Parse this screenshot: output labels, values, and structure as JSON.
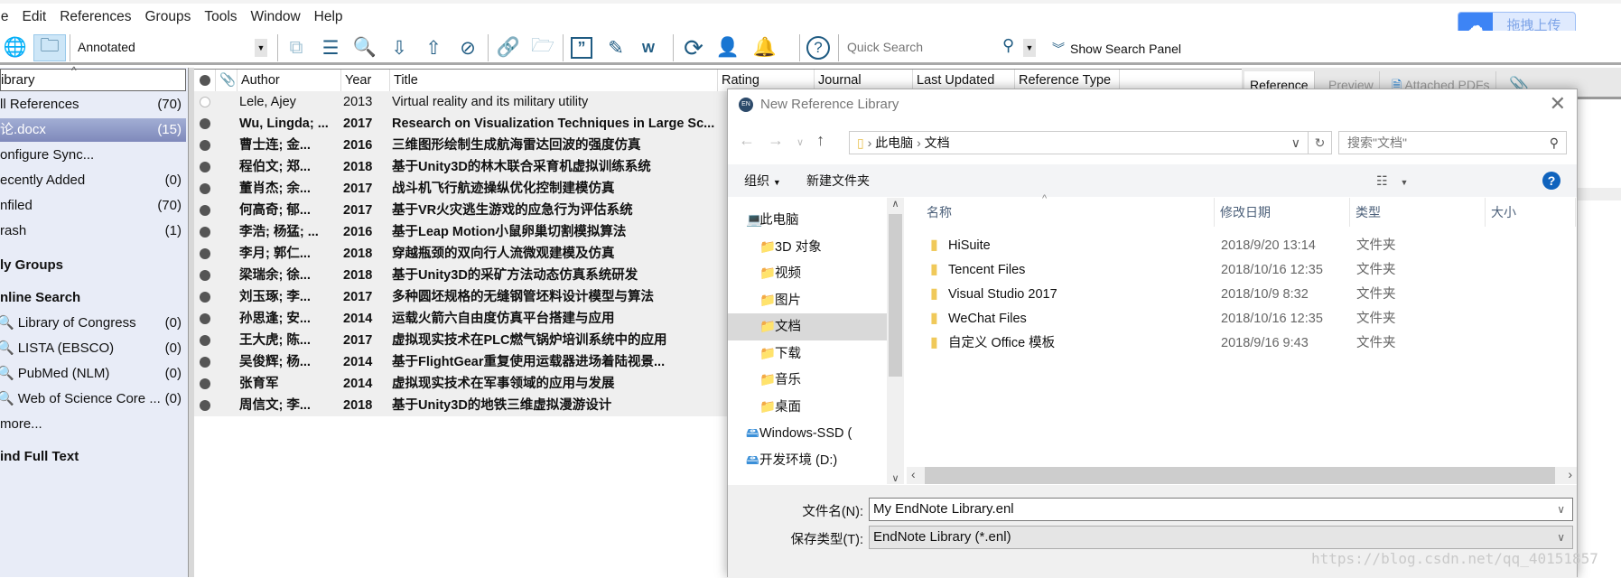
{
  "menu": [
    "ile",
    "Edit",
    "References",
    "Groups",
    "Tools",
    "Window",
    "Help"
  ],
  "toolbar": {
    "style": "Annotated",
    "quick_search_placeholder": "Quick Search",
    "show_search_panel": "Show Search Panel",
    "icons": [
      "online-search-globe-icon",
      "integrated-library-icon",
      "copy-to-group-icon",
      "new-reference-icon",
      "find-online-icon",
      "import-icon",
      "export-icon",
      "find-pdf-icon",
      "link-icon",
      "open-folder-icon",
      "insert-citation-icon",
      "edit-citation-icon",
      "word-icon",
      "sync-icon",
      "share-icon",
      "notifications-icon",
      "help-icon"
    ]
  },
  "baidu": {
    "label": "拖拽上传"
  },
  "sidebar": {
    "header": "ibrary",
    "items": [
      {
        "label": "ll References",
        "count": "(70)"
      },
      {
        "label": "论.docx",
        "count": "(15)",
        "selected": true
      },
      {
        "label": "onfigure Sync...",
        "count": ""
      },
      {
        "label": "ecently Added",
        "count": "(0)"
      },
      {
        "label": "nfiled",
        "count": "(70)"
      },
      {
        "label": "rash",
        "count": "(1)"
      }
    ],
    "my_groups": "ly Groups",
    "online_search": "nline Search",
    "online": [
      {
        "label": "Library of Congress",
        "count": "(0)"
      },
      {
        "label": "LISTA (EBSCO)",
        "count": "(0)"
      },
      {
        "label": "PubMed (NLM)",
        "count": "(0)"
      },
      {
        "label": "Web of Science Core ...",
        "count": "(0)"
      }
    ],
    "more": "more...",
    "find_full_text": "ind Full Text"
  },
  "list": {
    "columns": [
      "Author",
      "Year",
      "Title",
      "Rating",
      "Journal",
      "Last Updated",
      "Reference Type"
    ],
    "rows": [
      {
        "author": "Lele, Ajey",
        "year": "2013",
        "title": "Virtual reality and its military utility",
        "read": true
      },
      {
        "author": "Wu, Lingda; ...",
        "year": "2017",
        "title": "Research on Visualization Techniques in Large Sc...",
        "read": false
      },
      {
        "author": "曹士连; 金...",
        "year": "2016",
        "title": "三维图形绘制生成航海雷达回波的强度仿真",
        "read": false
      },
      {
        "author": "程伯文; 郑...",
        "year": "2018",
        "title": "基于Unity3D的林木联合采育机虚拟训练系统",
        "read": false
      },
      {
        "author": "董肖杰; 余...",
        "year": "2017",
        "title": "战斗机飞行航迹操纵优化控制建模仿真",
        "read": false
      },
      {
        "author": "何高奇; 郁...",
        "year": "2017",
        "title": "基于VR火灾逃生游戏的应急行为评估系统",
        "read": false
      },
      {
        "author": "李浩; 杨猛; ...",
        "year": "2016",
        "title": "基于Leap Motion小鼠卵巢切割模拟算法",
        "read": false
      },
      {
        "author": "李月; 郭仁...",
        "year": "2018",
        "title": "穿越瓶颈的双向行人流微观建模及仿真",
        "read": false
      },
      {
        "author": "梁瑞余; 徐...",
        "year": "2018",
        "title": "基于Unity3D的采矿方法动态仿真系统研发",
        "read": false
      },
      {
        "author": "刘玉琢; 李...",
        "year": "2017",
        "title": "多种圆坯规格的无缝钢管坯料设计模型与算法",
        "read": false
      },
      {
        "author": "孙思逢; 安...",
        "year": "2014",
        "title": "运载火箭六自由度仿真平台搭建与应用",
        "read": false
      },
      {
        "author": "王大虎; 陈...",
        "year": "2017",
        "title": "虚拟现实技术在PLC燃气锅炉培训系统中的应用",
        "read": false
      },
      {
        "author": "吴俊辉; 杨...",
        "year": "2014",
        "title": "基于FlightGear重复使用运载器进场着陆视景...",
        "read": false
      },
      {
        "author": "张育军",
        "year": "2014",
        "title": "虚拟现实技术在军事领域的应用与发展",
        "read": false
      },
      {
        "author": "周信文; 李...",
        "year": "2018",
        "title": "基于Unity3D的地铁三维虚拟漫游设计",
        "read": false
      }
    ]
  },
  "right_tabs": [
    "Reference",
    "Preview",
    "Attached PDFs"
  ],
  "dialog": {
    "title": "New Reference Library",
    "path": [
      "此电脑",
      "文档"
    ],
    "search_placeholder": "搜索\"文档\"",
    "organize": "组织",
    "new_folder": "新建文件夹",
    "nav": [
      "此电脑",
      "3D 对象",
      "视频",
      "图片",
      "文档",
      "下载",
      "音乐",
      "桌面",
      "Windows-SSD (",
      "开发环境 (D:)"
    ],
    "columns": [
      "名称",
      "修改日期",
      "类型",
      "大小"
    ],
    "files": [
      {
        "name": "HiSuite",
        "date": "2018/9/20 13:14",
        "type": "文件夹"
      },
      {
        "name": "Tencent Files",
        "date": "2018/10/16 12:35",
        "type": "文件夹"
      },
      {
        "name": "Visual Studio 2017",
        "date": "2018/10/9 8:32",
        "type": "文件夹"
      },
      {
        "name": "WeChat Files",
        "date": "2018/10/16 12:35",
        "type": "文件夹"
      },
      {
        "name": "自定义 Office 模板",
        "date": "2018/9/16 9:43",
        "type": "文件夹"
      }
    ],
    "filename_label": "文件名(N):",
    "filename": "My EndNote Library.enl",
    "savetype_label": "保存类型(T):",
    "savetype": "EndNote Library (*.enl)"
  },
  "watermark": "https://blog.csdn.net/qq_40151857"
}
